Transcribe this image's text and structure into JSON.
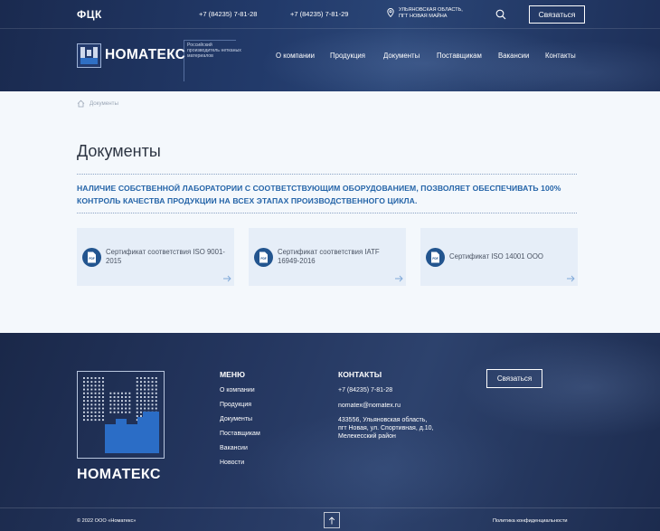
{
  "header": {
    "brand_mark": "ФЦК",
    "phone_1": "+7 (84235) 7-81-28",
    "phone_2": "+7 (84235) 7-81-29",
    "address_line1": "УЛЬЯНОВСКАЯ ОБЛАСТЬ,",
    "address_line2": "ПГТ НОВАЯ МАЙНА",
    "call_button": "Связаться",
    "logo_name": "НОМАТЕКС",
    "tagline": "Российский производитель нетканых материалов",
    "nav": [
      "О компании",
      "Продукция",
      "Документы",
      "Поставщикам",
      "Вакансии",
      "Контакты"
    ]
  },
  "breadcrumb": {
    "current": "Документы"
  },
  "main": {
    "title": "Документы",
    "lead": "НАЛИЧИЕ СОБСТВЕННОЙ ЛАБОРАТОРИИ С СООТВЕТСТВУЮЩИМ ОБОРУДОВАНИЕМ, ПОЗВОЛЯЕТ ОБЕСПЕЧИВАТЬ 100% КОНТРОЛЬ КАЧЕСТВА ПРОДУКЦИИ НА ВСЕХ ЭТАПАХ ПРОИЗВОДСТВЕННОГО ЦИКЛА.",
    "documents": [
      {
        "label": "Сертификат соответствия ISO 9001-2015",
        "icon": "pdf-icon"
      },
      {
        "label": "Сертификат соответствия IATF 16949-2016",
        "icon": "pdf-icon"
      },
      {
        "label": "Сертификат ISO 14001 ООО",
        "icon": "pdf-icon"
      }
    ]
  },
  "footer": {
    "logo_name": "НОМАТЕКС",
    "menu_title": "МЕНЮ",
    "menu": [
      "О компании",
      "Продукция",
      "Документы",
      "Поставщикам",
      "Вакансии",
      "Новости"
    ],
    "contacts_title": "КОНТАКТЫ",
    "phone": "+7 (84235) 7-81-28",
    "email": "nomatex@nomatex.ru",
    "address": [
      "433556, Ульяновская область,",
      "пгт Новая, ул. Спортивная, д.10,",
      "Мелекесский район"
    ],
    "call_button": "Связаться",
    "copyright": "© 2022 ООО «Номатекс»",
    "policy": "Политика конфиденциальности"
  },
  "colors": {
    "accent_blue": "#2464a8",
    "brand_red": "#e0313a",
    "dark_navy": "#1a2a4f"
  }
}
